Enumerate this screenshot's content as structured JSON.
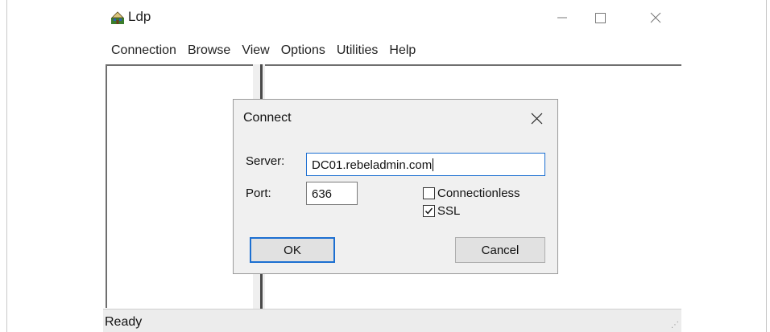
{
  "window": {
    "title": "Ldp",
    "icon": "ldp-app-icon"
  },
  "menubar": {
    "items": [
      "Connection",
      "Browse",
      "View",
      "Options",
      "Utilities",
      "Help"
    ]
  },
  "statusbar": {
    "text": "Ready"
  },
  "dialog": {
    "title": "Connect",
    "server_label": "Server:",
    "server_value": "DC01.rebeladmin.com",
    "port_label": "Port:",
    "port_value": "636",
    "connectionless_label": "Connectionless",
    "connectionless_checked": false,
    "ssl_label": "SSL",
    "ssl_checked": true,
    "ok_label": "OK",
    "cancel_label": "Cancel"
  },
  "colors": {
    "focus_accent": "#1c6fd1",
    "dialog_bg": "#f0f0f0",
    "statusbar_bg": "#ececec"
  }
}
